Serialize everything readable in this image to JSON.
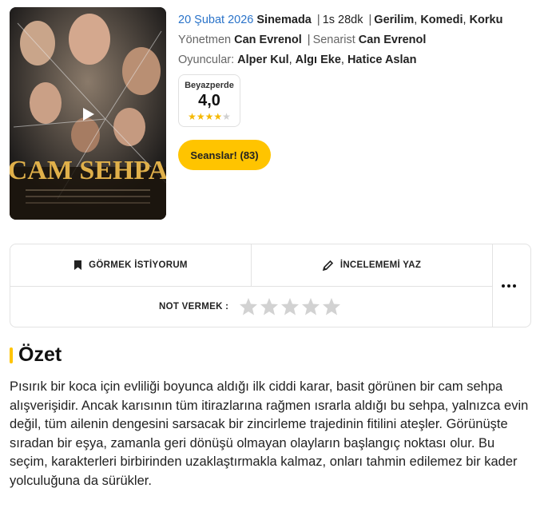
{
  "movie": {
    "poster_title": "CAM SEHPA",
    "release_date": "20 Şubat 2026",
    "release_status": "Sinemada",
    "duration": "1s 28dk",
    "genres": [
      "Gerilim",
      "Komedi",
      "Korku"
    ],
    "director_label": "Yönetmen",
    "director": "Can Evrenol",
    "writer_label": "Senarist",
    "writer": "Can Evrenol",
    "cast_label": "Oyuncular:",
    "cast": [
      "Alper Kul",
      "Algı Eke",
      "Hatice Aslan"
    ]
  },
  "rating": {
    "source": "Beyazperde",
    "value": "4,0",
    "stars_filled": 4,
    "stars_total": 5
  },
  "seans_button": "Seanslar! (83)",
  "actions": {
    "watchlist_label": "GÖRMEK İSTİYORUM",
    "review_label": "İNCELEMEMİ YAZ",
    "rate_label": "NOT VERMEK :"
  },
  "summary": {
    "title": "Özet",
    "text": "Pısırık bir koca için evliliği boyunca aldığı ilk ciddi karar, basit görünen bir cam sehpa alışverişidir. Ancak karısının tüm itirazlarına rağmen ısrarla aldığı bu sehpa, yalnızca evin değil, tüm ailenin dengesini sarsacak bir zincirleme trajedinin fitilini ateşler. Görünüşte sıradan bir eşya, zamanla geri dönüşü olmayan olayların başlangıç noktası olur. Bu seçim, karakterleri birbirinden uzaklaştırmakla kalmaz, onları tahmin edilemez bir kader yolculuğuna da sürükler."
  },
  "colors": {
    "accent": "#ffc400",
    "link_blue": "#2a73c9",
    "star_on": "#f5b800",
    "star_off": "#d0d0d0"
  }
}
